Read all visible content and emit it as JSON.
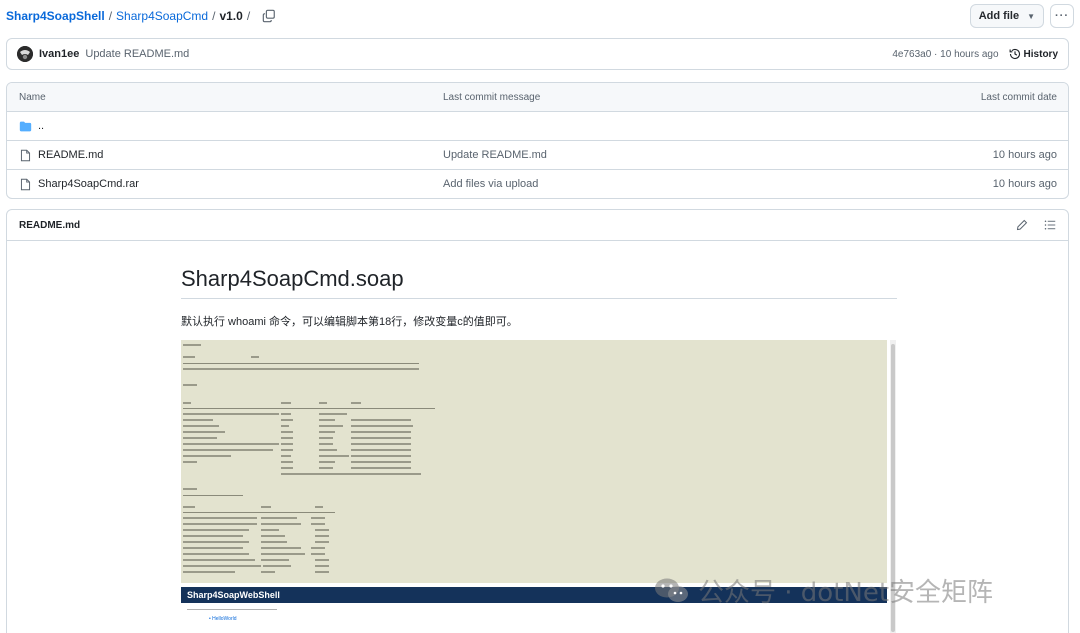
{
  "breadcrumb": {
    "repo": "Sharp4SoapShell",
    "folder": "Sharp4SoapCmd",
    "current": "v1.0",
    "sep": "/"
  },
  "actions": {
    "add_file": "Add file",
    "more": "···"
  },
  "commit": {
    "author": "Ivan1ee",
    "message": "Update README.md",
    "meta": "4e763a0 · 10 hours ago",
    "history_label": "History"
  },
  "file_table": {
    "headers": {
      "name": "Name",
      "message": "Last commit message",
      "date": "Last commit date"
    },
    "parent": "..",
    "rows": [
      {
        "name": "README.md",
        "message": "Update README.md",
        "date": "10 hours ago"
      },
      {
        "name": "Sharp4SoapCmd.rar",
        "message": "Add files via upload",
        "date": "10 hours ago"
      }
    ]
  },
  "readme": {
    "label": "README.md",
    "title": "Sharp4SoapCmd.soap",
    "paragraph": "默认执行 whoami 命令，可以编辑脚本第18行，修改变量c的值即可。",
    "web_banner": "Sharp4SoapWebShell",
    "web_link": "HelloWorld"
  },
  "watermark": "公众号 · dotNet安全矩阵",
  "colors": {
    "link": "#0969da",
    "folder": "#54aeff",
    "terminal_bg": "#e3e3cf",
    "banner": "#14325a"
  }
}
